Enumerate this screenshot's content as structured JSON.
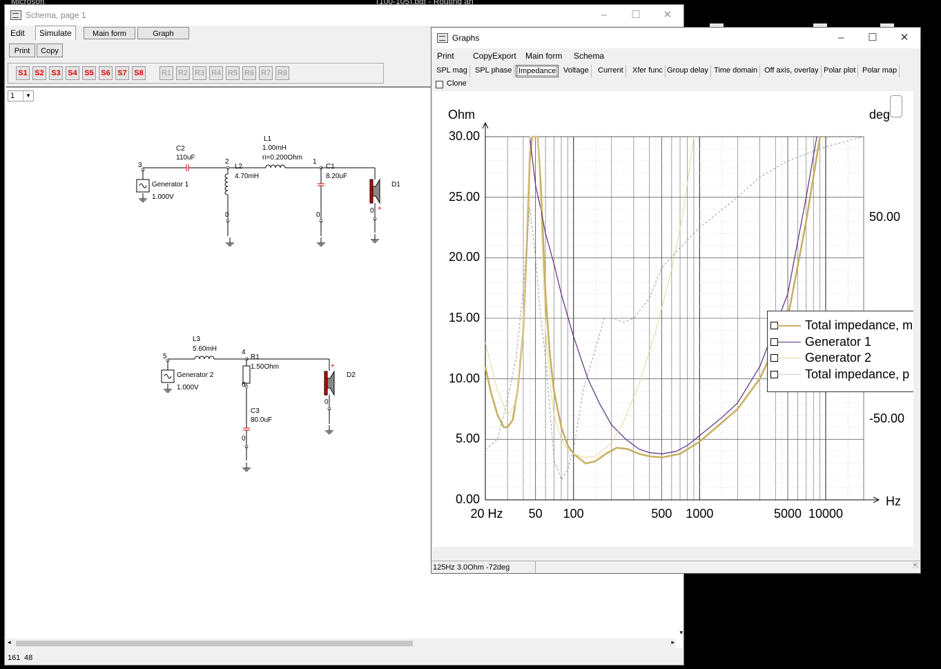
{
  "background": {
    "top_text_left": "Microsoft",
    "top_text_center": "(100-105).pdf - Routing an"
  },
  "schema_window": {
    "title": "Schema, page 1",
    "menu": {
      "edit": "Edit",
      "simulate": "Simulate",
      "main_form": "Main form",
      "graph": "Graph"
    },
    "toolbar": {
      "print": "Print",
      "copy": "Copy"
    },
    "s_buttons": [
      "S1",
      "S2",
      "S3",
      "S4",
      "S5",
      "S6",
      "S7",
      "S8"
    ],
    "r_buttons": [
      "R1",
      "R2",
      "R3",
      "R4",
      "R5",
      "R6",
      "R7",
      "R8"
    ],
    "page_select": "1",
    "status": {
      "x": "161",
      "y": "48"
    },
    "circuit": {
      "c2": {
        "name": "C2",
        "value": "110uF"
      },
      "l1": {
        "name": "L1",
        "value": "1.00mH",
        "ri": "ri=0.200Ohm"
      },
      "l2": {
        "name": "L2",
        "value": "4.70mH"
      },
      "c1": {
        "name": "C1",
        "value": "8.20uF"
      },
      "gen1": {
        "name": "Generator 1",
        "value": "1.000V"
      },
      "d1": "D1",
      "l3": {
        "name": "L3",
        "value": "5.60mH"
      },
      "r1": {
        "name": "R1",
        "value": "1.50Ohm"
      },
      "c3": {
        "name": "C3",
        "value": "80.0uF"
      },
      "gen2": {
        "name": "Generator 2",
        "value": "1.000V"
      },
      "d2": "D2",
      "nodes": {
        "n3": "3",
        "n2": "2",
        "n1": "1",
        "n0a": "0",
        "n0b": "0",
        "n0c": "0",
        "n5": "5",
        "n4": "4",
        "n6": "6",
        "n0d": "0",
        "n0e": "0"
      }
    }
  },
  "graphs_window": {
    "title": "Graphs",
    "menu": [
      "Print",
      "Copy",
      "Export",
      "Main form",
      "Schema"
    ],
    "tabs": [
      "SPL mag",
      "SPL phase",
      "Impedance",
      "Voltage",
      "Current",
      "Xfer func",
      "Group delay",
      "Time domain",
      "Off axis, overlay",
      "Polar plot",
      "Polar map"
    ],
    "active_tab": "Impedance",
    "clone_label": "Clone",
    "status_text": "125Hz 3.0Ohm -72deg"
  },
  "chart_data": {
    "type": "line",
    "ylabel": "Ohm",
    "y2label": "deg",
    "xlabel": "Hz",
    "x_scale": "log",
    "xlim": [
      20,
      20000
    ],
    "ylim": [
      0,
      30
    ],
    "y2lim": [
      -90,
      90
    ],
    "x_ticks": [
      {
        "v": 20,
        "label": "20 Hz"
      },
      {
        "v": 50,
        "label": "50"
      },
      {
        "v": 100,
        "label": "100"
      },
      {
        "v": 500,
        "label": "500"
      },
      {
        "v": 1000,
        "label": "1000"
      },
      {
        "v": 5000,
        "label": "5000"
      },
      {
        "v": 10000,
        "label": "10000"
      }
    ],
    "y_ticks": [
      "0.00",
      "5.00",
      "10.00",
      "15.00",
      "20.00",
      "25.00",
      "30.00"
    ],
    "y2_ticks": [
      {
        "v": 50,
        "label": "50.00"
      },
      {
        "v": -50,
        "label": "-50.00"
      }
    ],
    "grid": true,
    "legend_position": "right",
    "series": [
      {
        "name": "Total impedance, m",
        "color": "#c8b062",
        "width": 2.6,
        "dash": "",
        "points": [
          [
            20,
            11
          ],
          [
            22,
            9
          ],
          [
            25,
            7
          ],
          [
            28,
            6
          ],
          [
            30,
            6
          ],
          [
            33,
            6.6
          ],
          [
            36,
            9
          ],
          [
            40,
            14
          ],
          [
            43,
            22
          ],
          [
            45,
            28
          ],
          [
            47,
            30
          ],
          [
            52,
            30
          ],
          [
            55,
            26
          ],
          [
            60,
            17
          ],
          [
            65,
            12
          ],
          [
            70,
            9
          ],
          [
            80,
            6
          ],
          [
            90,
            4.5
          ],
          [
            100,
            3.8
          ],
          [
            125,
            3.0
          ],
          [
            150,
            3.2
          ],
          [
            180,
            3.8
          ],
          [
            220,
            4.3
          ],
          [
            270,
            4.2
          ],
          [
            330,
            3.8
          ],
          [
            400,
            3.6
          ],
          [
            500,
            3.5
          ],
          [
            700,
            3.8
          ],
          [
            1000,
            4.8
          ],
          [
            2000,
            7.5
          ],
          [
            3000,
            10
          ],
          [
            5000,
            15
          ],
          [
            7000,
            23
          ],
          [
            9000,
            30
          ]
        ]
      },
      {
        "name": "Generator 1",
        "color": "#5a2a7a",
        "width": 1.2,
        "dash": "",
        "points": [
          [
            45,
            30
          ],
          [
            50,
            26
          ],
          [
            55,
            24
          ],
          [
            60,
            22
          ],
          [
            70,
            19.5
          ],
          [
            80,
            17
          ],
          [
            100,
            13.5
          ],
          [
            130,
            10
          ],
          [
            160,
            8
          ],
          [
            200,
            6.2
          ],
          [
            260,
            5
          ],
          [
            330,
            4.2
          ],
          [
            400,
            3.9
          ],
          [
            500,
            3.8
          ],
          [
            650,
            4
          ],
          [
            800,
            4.5
          ],
          [
            1000,
            5.3
          ],
          [
            1500,
            6.8
          ],
          [
            2000,
            8
          ],
          [
            3000,
            11
          ],
          [
            5000,
            17
          ],
          [
            7000,
            25
          ],
          [
            8500,
            30
          ]
        ]
      },
      {
        "name": "Generator 2",
        "color": "#e4d79a",
        "width": 1.0,
        "dash": "",
        "points": [
          [
            20,
            13
          ],
          [
            25,
            9
          ],
          [
            30,
            7
          ],
          [
            35,
            8
          ],
          [
            40,
            14
          ],
          [
            43,
            24
          ],
          [
            45,
            30
          ],
          [
            52,
            30
          ],
          [
            55,
            24
          ],
          [
            60,
            14
          ],
          [
            65,
            10
          ],
          [
            70,
            7
          ],
          [
            80,
            5
          ],
          [
            90,
            4.2
          ],
          [
            100,
            3.8
          ],
          [
            120,
            3.5
          ],
          [
            150,
            3.6
          ],
          [
            200,
            4.7
          ],
          [
            250,
            6.5
          ],
          [
            330,
            9.5
          ],
          [
            450,
            14
          ],
          [
            600,
            19
          ],
          [
            750,
            24
          ],
          [
            900,
            30
          ]
        ]
      },
      {
        "name": "Total impedance, p",
        "color": "#9a9a9a",
        "width": 1.0,
        "dash": "3,3",
        "axis": "y2",
        "points": [
          [
            20,
            -65
          ],
          [
            25,
            -60
          ],
          [
            30,
            -40
          ],
          [
            35,
            -20
          ],
          [
            40,
            15
          ],
          [
            45,
            55
          ],
          [
            50,
            30
          ],
          [
            55,
            0
          ],
          [
            60,
            -20
          ],
          [
            65,
            -45
          ],
          [
            70,
            -70
          ],
          [
            80,
            -80
          ],
          [
            90,
            -75
          ],
          [
            100,
            -65
          ],
          [
            120,
            -35
          ],
          [
            150,
            -15
          ],
          [
            175,
            0
          ],
          [
            200,
            0
          ],
          [
            250,
            -2
          ],
          [
            300,
            0
          ],
          [
            400,
            10
          ],
          [
            500,
            25
          ],
          [
            700,
            35
          ],
          [
            1000,
            45
          ],
          [
            2000,
            60
          ],
          [
            3000,
            70
          ],
          [
            5000,
            78
          ],
          [
            10000,
            85
          ],
          [
            20000,
            90
          ]
        ]
      }
    ]
  }
}
